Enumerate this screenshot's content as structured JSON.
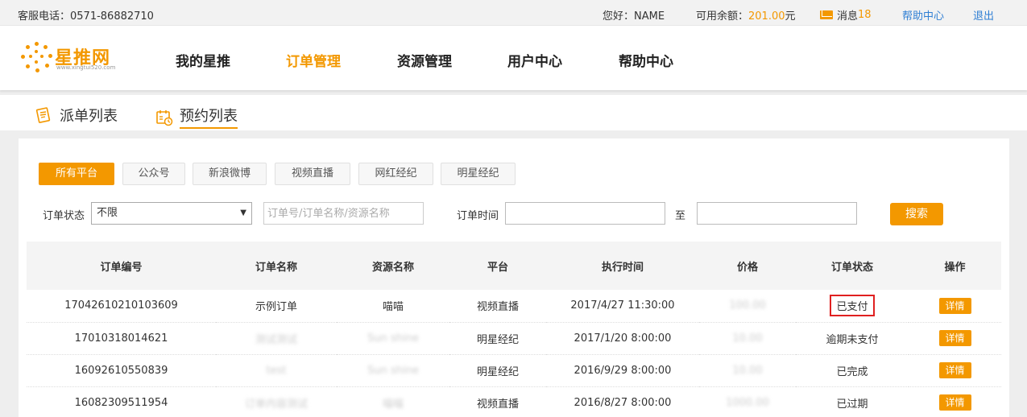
{
  "topbar": {
    "hotline": "客服电话：0571-86882710",
    "hello": "您好：NAME",
    "balance_label": "可用余额：",
    "balance_amount": "201.00",
    "balance_unit": "元",
    "message_label": "消息",
    "message_count": "18",
    "help": "帮助中心",
    "logout": "退出"
  },
  "logo": {
    "brand": "星推网",
    "url": "www.xingtui520.com"
  },
  "nav": [
    "我的星推",
    "订单管理",
    "资源管理",
    "用户中心",
    "帮助中心"
  ],
  "subtabs": [
    "派单列表",
    "预约列表"
  ],
  "platform_chips": [
    "所有平台",
    "公众号",
    "新浪微博",
    "视频直播",
    "网红经纪",
    "明星经纪"
  ],
  "filters": {
    "status_label": "订单状态",
    "status_value": "不限",
    "search_placeholder": "订单号/订单名称/资源名称",
    "time_label": "订单时间",
    "to_label": "至",
    "search_button": "搜索"
  },
  "table": {
    "headers": [
      "订单编号",
      "订单名称",
      "资源名称",
      "平台",
      "执行时间",
      "价格",
      "订单状态",
      "操作"
    ],
    "rows": [
      {
        "id": "17042610210103609",
        "name": "示例订单",
        "resource": "喵喵",
        "platform": "视频直播",
        "time": "2017/4/27 11:30:00",
        "price": "100.00",
        "status": "已支付",
        "action": "详情"
      },
      {
        "id": "17010318014621",
        "name": "测试测试",
        "resource": "Sun shine",
        "platform": "明星经纪",
        "time": "2017/1/20 8:00:00",
        "price": "10.00",
        "status": "逾期未支付",
        "action": "详情"
      },
      {
        "id": "16092610550839",
        "name": "test",
        "resource": "Sun shine",
        "platform": "明星经纪",
        "time": "2016/9/29 8:00:00",
        "price": "10.00",
        "status": "已完成",
        "action": "详情"
      },
      {
        "id": "16082309511954",
        "name": "订单内容测试",
        "resource": "喵喵",
        "platform": "视频直播",
        "time": "2016/8/27 8:00:00",
        "price": "1000.00",
        "status": "已过期",
        "action": "详情"
      }
    ]
  },
  "colors": {
    "accent": "#f39800",
    "link": "#2f7fd4",
    "highlight": "#e02020"
  }
}
